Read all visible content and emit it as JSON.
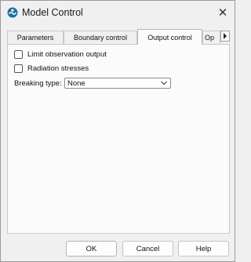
{
  "window": {
    "title": "Model Control"
  },
  "tabs": [
    {
      "label": "Parameters",
      "active": false
    },
    {
      "label": "Boundary control",
      "active": false
    },
    {
      "label": "Output control",
      "active": true
    },
    {
      "label": "Op",
      "active": false
    }
  ],
  "options": {
    "limit_observation_output": {
      "label": "Limit observation output",
      "checked": false
    },
    "radiation_stresses": {
      "label": "Radiation stresses",
      "checked": false
    }
  },
  "breaking_type": {
    "label": "Breaking type:",
    "value": "None"
  },
  "buttons": {
    "ok": "OK",
    "cancel": "Cancel",
    "help": "Help"
  },
  "icons": {
    "app": "model-control-app-icon",
    "close": "close-icon",
    "tab_scroll": "chevron-right-icon",
    "dropdown": "chevron-down-icon"
  },
  "colors": {
    "app_icon": "#1e6fa3",
    "window_bg": "#f0f0f0",
    "panel_bg": "#fbfbfb"
  }
}
